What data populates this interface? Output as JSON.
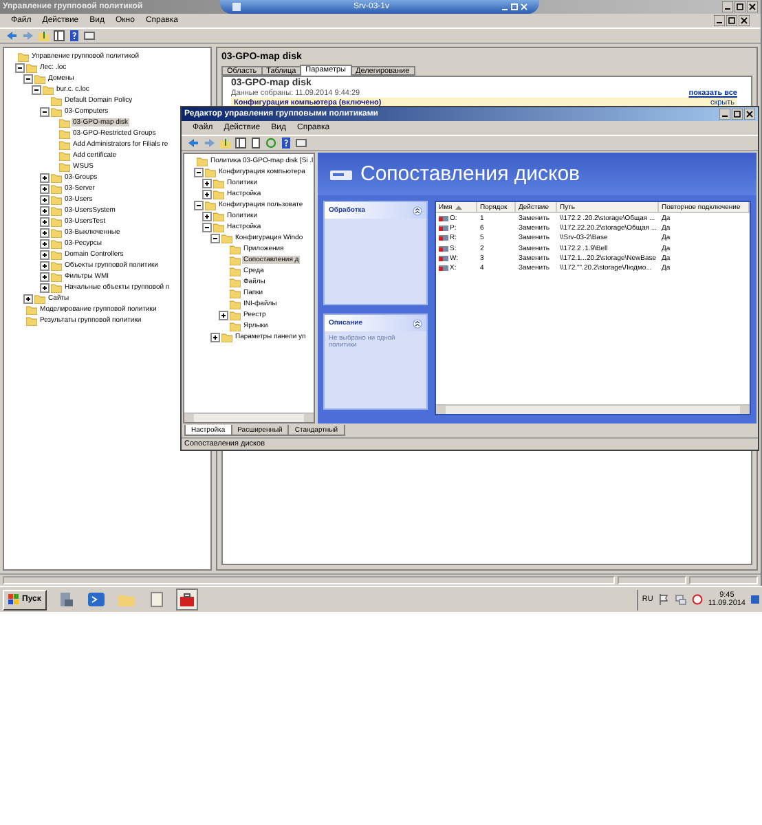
{
  "window": {
    "title": "Управление групповой политикой"
  },
  "remote_bar": {
    "title": "Srv-03-1v"
  },
  "menu": [
    "Файл",
    "Действие",
    "Вид",
    "Окно",
    "Справка"
  ],
  "tree": [
    {
      "label": "Управление групповой политикой",
      "selected": false,
      "children": [
        {
          "label": "Лес: .loc",
          "expanded": true,
          "selected": false,
          "children": [
            {
              "label": "Домены",
              "expanded": true,
              "selected": false,
              "children": [
                {
                  "label": "bur.c. c.loc",
                  "expanded": true,
                  "selected": false,
                  "children": [
                    {
                      "label": "Default Domain Policy",
                      "selected": false
                    },
                    {
                      "label": "03-Computers",
                      "expanded": true,
                      "selected": false,
                      "children": [
                        {
                          "label": "03-GPO-map disk",
                          "selected": true
                        },
                        {
                          "label": "03-GPO-Restricted Groups",
                          "selected": false
                        },
                        {
                          "label": "Add Administrators for Filials re",
                          "selected": false
                        },
                        {
                          "label": "Add certificate",
                          "selected": false
                        },
                        {
                          "label": "WSUS",
                          "selected": false
                        }
                      ]
                    },
                    {
                      "label": "03-Groups",
                      "expanded": false,
                      "selected": false
                    },
                    {
                      "label": "03-Server",
                      "expanded": false,
                      "selected": false
                    },
                    {
                      "label": "03-Users",
                      "expanded": false,
                      "selected": false
                    },
                    {
                      "label": "03-UsersSystem",
                      "expanded": false,
                      "selected": false
                    },
                    {
                      "label": "03-UsersTest",
                      "expanded": false,
                      "selected": false
                    },
                    {
                      "label": "03-Выключенные",
                      "expanded": false,
                      "selected": false
                    },
                    {
                      "label": "03-Ресурсы",
                      "expanded": false,
                      "selected": false
                    },
                    {
                      "label": "Domain Controllers",
                      "expanded": false,
                      "selected": false
                    },
                    {
                      "label": "Объекты групповой политики",
                      "expanded": false,
                      "selected": false
                    },
                    {
                      "label": "Фильтры WMI",
                      "expanded": false,
                      "selected": false
                    },
                    {
                      "label": "Начальные объекты групповой п",
                      "expanded": false,
                      "selected": false
                    }
                  ]
                }
              ]
            },
            {
              "label": "Сайты",
              "expanded": false,
              "selected": false
            }
          ]
        },
        {
          "label": "Моделирование групповой политики",
          "selected": false
        },
        {
          "label": "Результаты групповой политики",
          "selected": false
        }
      ]
    }
  ],
  "gpo_panel": {
    "title": "03-GPO-map disk",
    "tabs": [
      {
        "label": "Область",
        "selected": false
      },
      {
        "label": "Таблица",
        "selected": false
      },
      {
        "label": "Параметры",
        "selected": true
      },
      {
        "label": "Делегирование",
        "selected": false
      }
    ],
    "report": {
      "title": "03-GPO-map disk",
      "collected": "Данные собраны: 11.09.2014 9:44:29",
      "show_all": "показать все",
      "section": "Конфигурация компьютера (включено)",
      "hide": "скрыть"
    }
  },
  "editor": {
    "title": "Редактор управления групповыми политиками",
    "menu": [
      "Файл",
      "Действие",
      "Вид",
      "Справка"
    ],
    "tree": [
      {
        "label": "Политика 03-GPO-map disk [Si .l",
        "selected": false,
        "children": [
          {
            "label": "Конфигурация компьютера",
            "expanded": true,
            "selected": false,
            "children": [
              {
                "label": "Политики",
                "expanded": false,
                "selected": false
              },
              {
                "label": "Настройка",
                "expanded": false,
                "selected": false
              }
            ]
          },
          {
            "label": "Конфигурация пользовате",
            "expanded": true,
            "selected": false,
            "children": [
              {
                "label": "Политики",
                "expanded": false,
                "selected": false
              },
              {
                "label": "Настройка",
                "expanded": true,
                "selected": false,
                "children": [
                  {
                    "label": "Конфигурация Windo",
                    "expanded": true,
                    "selected": false,
                    "children": [
                      {
                        "label": "Приложения",
                        "selected": false
                      },
                      {
                        "label": "Сопоставления д",
                        "selected": true
                      },
                      {
                        "label": "Среда",
                        "selected": false
                      },
                      {
                        "label": "Файлы",
                        "selected": false
                      },
                      {
                        "label": "Папки",
                        "selected": false
                      },
                      {
                        "label": "INI-файлы",
                        "selected": false
                      },
                      {
                        "label": "Реестр",
                        "expanded": false,
                        "selected": false
                      },
                      {
                        "label": "Ярлыки",
                        "selected": false
                      }
                    ]
                  },
                  {
                    "label": "Параметры панели уп",
                    "expanded": false,
                    "selected": false
                  }
                ]
              }
            ]
          }
        ]
      }
    ],
    "heading": "Сопоставления дисков",
    "cards": [
      {
        "title": "Обработка"
      },
      {
        "title": "Описание",
        "text": "Не выбрано ни одной политики"
      }
    ],
    "table": {
      "columns": [
        "Имя",
        "Порядок",
        "Действие",
        "Путь",
        "Повторное подключение"
      ],
      "rows": [
        [
          "O:",
          "1",
          "Заменить",
          "\\\\172.2 .20.2\\storage\\Общая ...",
          "Да"
        ],
        [
          "P:",
          "6",
          "Заменить",
          "\\\\172.22.20.2\\storage\\Общая ...",
          "Да"
        ],
        [
          "R:",
          "5",
          "Заменить",
          "\\\\Srv-03-2\\Base",
          "Да"
        ],
        [
          "S:",
          "2",
          "Заменить",
          "\\\\172.2 .1.9\\Bell",
          "Да"
        ],
        [
          "W:",
          "3",
          "Заменить",
          "\\\\172.1...20.2\\storage\\NewBase",
          "Да"
        ],
        [
          "X:",
          "4",
          "Заменить",
          "\\\\172.\"\".20.2\\storage\\Людмо...",
          "Да"
        ]
      ]
    },
    "tabs": [
      {
        "label": "Настройка",
        "selected": true
      },
      {
        "label": "Расширенный",
        "selected": false
      },
      {
        "label": "Стандартный",
        "selected": false
      }
    ],
    "status": "Сопоставления дисков"
  },
  "taskbar": {
    "start": "Пуск",
    "language": "RU",
    "time": "9:45",
    "date": "11.09.2014"
  }
}
